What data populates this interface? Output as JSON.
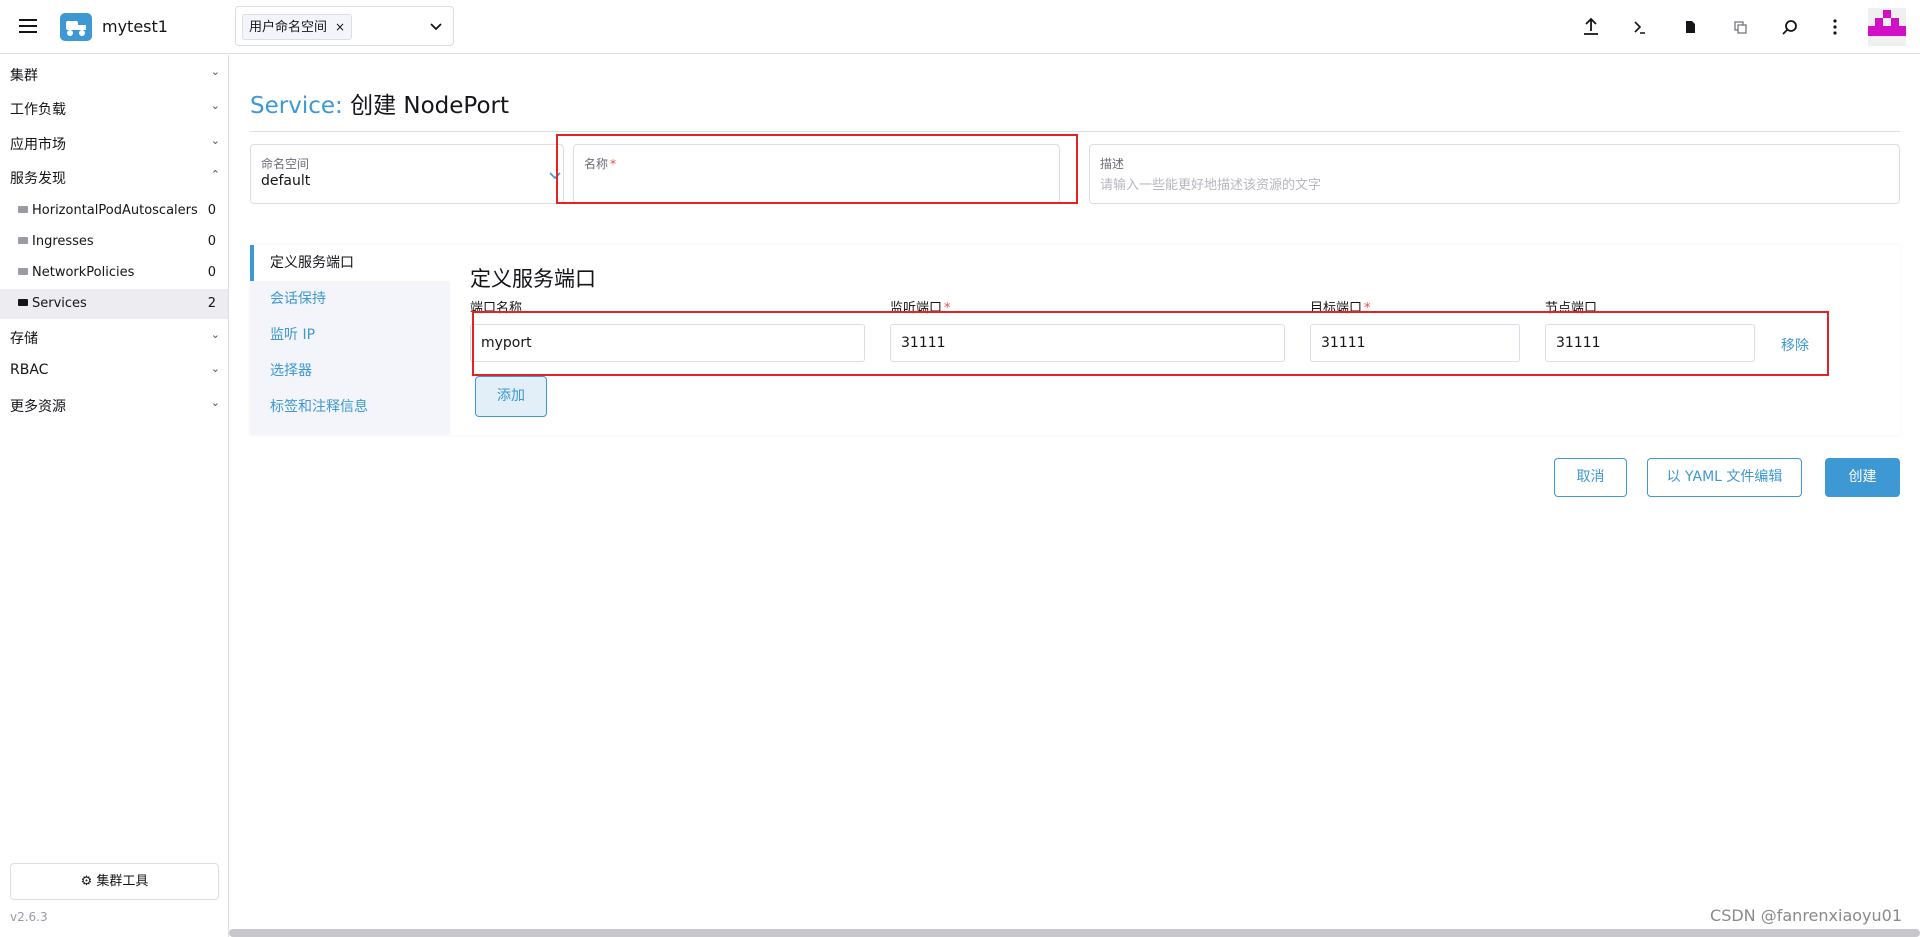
{
  "header": {
    "cluster_name": "mytest1",
    "namespace_tag": "用户命名空间",
    "namespace_remove": "×",
    "icons": [
      "upload-icon",
      "terminal-icon",
      "file-icon",
      "copy-icon",
      "search-icon",
      "more-icon"
    ]
  },
  "sidebar": {
    "groups": [
      {
        "label": "集群",
        "expanded": false
      },
      {
        "label": "工作负载",
        "expanded": false
      },
      {
        "label": "应用市场",
        "expanded": false
      },
      {
        "label": "服务发现",
        "expanded": true
      }
    ],
    "items": [
      {
        "label": "HorizontalPodAutoscalers",
        "count": "0"
      },
      {
        "label": "Ingresses",
        "count": "0"
      },
      {
        "label": "NetworkPolicies",
        "count": "0"
      },
      {
        "label": "Services",
        "count": "2",
        "active": true
      }
    ],
    "groups_after": [
      {
        "label": "存储"
      },
      {
        "label": "RBAC"
      },
      {
        "label": "更多资源"
      }
    ],
    "tools_button": "集群工具",
    "version": "v2.6.3"
  },
  "main": {
    "title_prefix": "Service:",
    "title_rest": "创建 NodePort",
    "namespace_field": {
      "label": "命名空间",
      "value": "default"
    },
    "name_field": {
      "label": "名称",
      "value": ""
    },
    "desc_field": {
      "label": "描述",
      "placeholder": "请输入一些能更好地描述该资源的文字"
    }
  },
  "tabs": [
    "定义服务端口",
    "会话保持",
    "监听 IP",
    "选择器",
    "标签和注释信息"
  ],
  "ports": {
    "title": "定义服务端口",
    "columns": [
      "端口名称",
      "监听端口",
      "目标端口",
      "节点端口"
    ],
    "row": {
      "name": "myport",
      "port": "31111",
      "target": "31111",
      "node": "31111"
    },
    "remove_label": "移除",
    "add_label": "添加"
  },
  "actions": {
    "cancel": "取消",
    "yaml": "以 YAML 文件编辑",
    "create": "创建"
  },
  "watermark": "CSDN @fanrenxiaoyu01",
  "colors": {
    "accent": "#3d98d3",
    "highlight": "#e52121"
  }
}
